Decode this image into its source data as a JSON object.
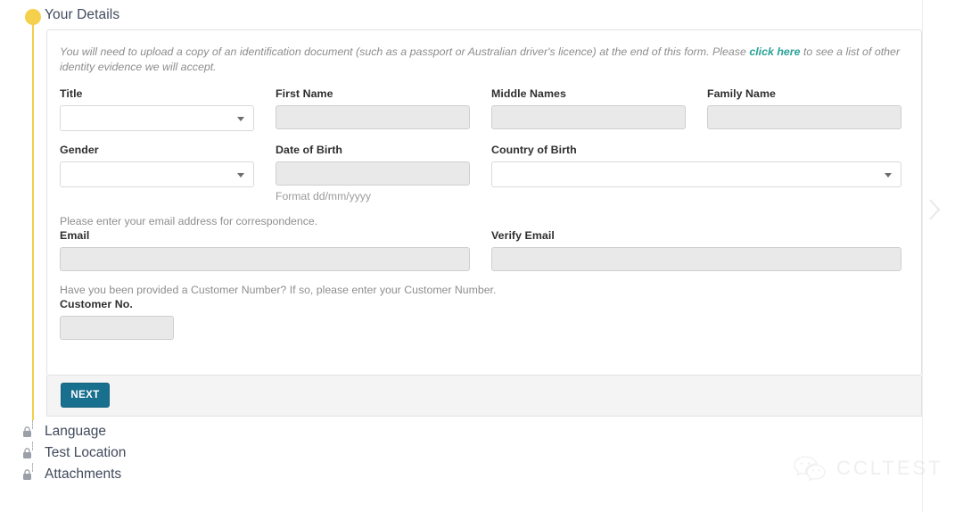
{
  "stepper": {
    "active_step": "Your Details",
    "active_dot_color": "#f5d04c",
    "rail_color": "#f3cf4d",
    "locked_steps": [
      {
        "label": "Language",
        "icon": "lock-icon"
      },
      {
        "label": "Test Location",
        "icon": "lock-icon"
      },
      {
        "label": "Attachments",
        "icon": "lock-icon"
      }
    ]
  },
  "form": {
    "intro": {
      "before_link": "You will need to upload a copy of an identification document (such as a passport or Australian driver's licence) at the end of this form.  Please ",
      "link_text": "click here",
      "after_link": " to see a list of other identity evidence we will accept.",
      "link_color": "#2aa198"
    },
    "fields": {
      "title": {
        "label": "Title",
        "value": "",
        "type": "select"
      },
      "first_name": {
        "label": "First Name",
        "value": "",
        "type": "text"
      },
      "middle_names": {
        "label": "Middle Names",
        "value": "",
        "type": "text"
      },
      "family_name": {
        "label": "Family Name",
        "value": "",
        "type": "text"
      },
      "gender": {
        "label": "Gender",
        "value": "",
        "type": "select"
      },
      "date_of_birth": {
        "label": "Date of Birth",
        "value": "",
        "type": "text",
        "hint": "Format dd/mm/yyyy"
      },
      "country_of_birth": {
        "label": "Country of Birth",
        "value": "",
        "type": "select"
      },
      "email": {
        "label": "Email",
        "value": "",
        "type": "text",
        "note": "Please enter your email address for correspondence."
      },
      "verify_email": {
        "label": "Verify Email",
        "value": "",
        "type": "text"
      },
      "customer_no": {
        "label": "Customer No.",
        "value": "",
        "type": "text",
        "note": "Have you been provided a Customer Number? If so, please enter your Customer Number."
      }
    },
    "footer": {
      "next_label": "NEXT",
      "next_color": "#186f8e"
    }
  },
  "watermark": {
    "text": "CCLTEST",
    "icon": "wechat-icon"
  },
  "edge": {
    "chevron": "chevron-right-icon"
  }
}
